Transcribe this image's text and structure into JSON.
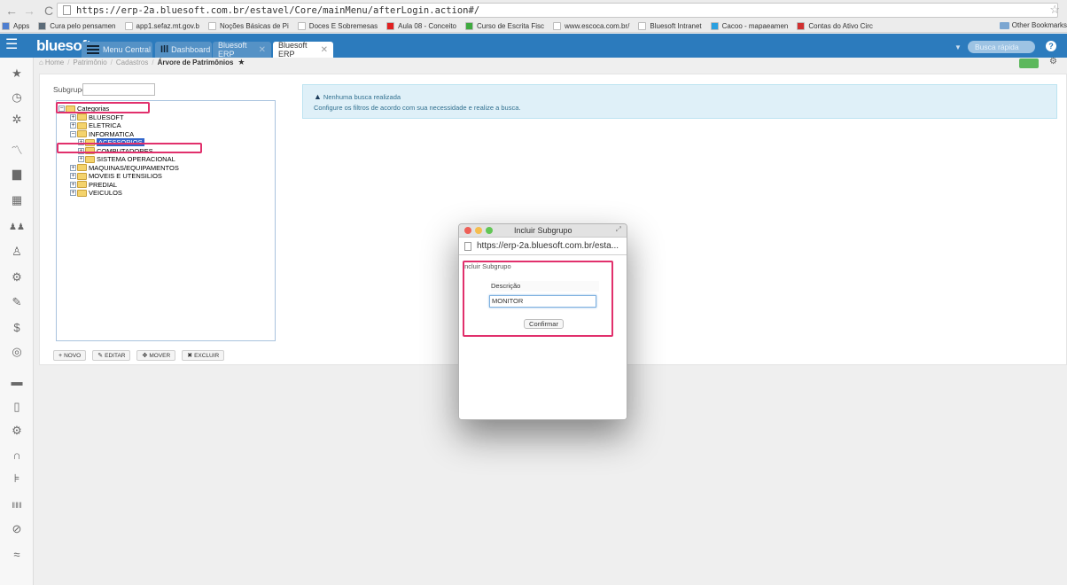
{
  "browser": {
    "url": "https://erp-2a.bluesoft.com.br/estavel/Core/mainMenu/afterLogin.action#/",
    "bookmarks": [
      {
        "label": "Apps",
        "color": "#4f7fd0"
      },
      {
        "label": "Cura pelo pensamen",
        "color": "#5b6b78"
      },
      {
        "label": "app1.sefaz.mt.gov.b",
        "color": "#ffffff"
      },
      {
        "label": "Noções Básicas de Pi",
        "color": "#ffffff"
      },
      {
        "label": "Doces E Sobremesas",
        "color": "#ffffff"
      },
      {
        "label": "Aula 08 - Conceito",
        "color": "#e02020"
      },
      {
        "label": "Curso de Escrita Fisc",
        "color": "#3faa3f"
      },
      {
        "label": "www.escoca.com.br/",
        "color": "#ffffff"
      },
      {
        "label": "Bluesoft Intranet",
        "color": "#ffffff"
      },
      {
        "label": "Cacoo - mapaeamen",
        "color": "#2aa0e0"
      },
      {
        "label": "Contas do Ativo Circ",
        "color": "#d03030"
      }
    ],
    "other_bookmarks": "Other Bookmarks"
  },
  "header": {
    "logo": "bluesoft",
    "tabs": [
      {
        "label": "Menu Central",
        "active": false
      },
      {
        "label": "Dashboard",
        "active": false
      },
      {
        "label": "Bluesoft ERP",
        "active": false
      },
      {
        "label": "Bluesoft ERP",
        "active": true
      }
    ],
    "quick_search_placeholder": "Busca rápida"
  },
  "sidebar": {
    "icons": [
      "star-icon",
      "clock-icon",
      "gear-icon",
      "chart-icon",
      "briefcase-icon",
      "calculator-icon",
      "users-icon",
      "person-icon",
      "cogs-icon",
      "wrench-icon",
      "dollar-icon",
      "dashboard-icon",
      "truck-icon",
      "tablet-icon",
      "gears-icon",
      "headset-icon",
      "cart-icon",
      "barcode-icon",
      "check-circle-icon",
      "sync-icon"
    ]
  },
  "breadcrumb": {
    "items": [
      "Home",
      "Patrimônio",
      "Cadastros",
      "Árvore de Patrimônios"
    ]
  },
  "tree_panel": {
    "subgrupo_label": "Subgrupo:",
    "subgrupo_value": "",
    "nodes": [
      {
        "label": "Categorias",
        "level": 0,
        "expanded": true
      },
      {
        "label": "BLUESOFT",
        "level": 1,
        "expanded": false
      },
      {
        "label": "ELETRICA",
        "level": 1,
        "expanded": false
      },
      {
        "label": "INFORMATICA",
        "level": 1,
        "expanded": true
      },
      {
        "label": "ACESSORIOS",
        "level": 2,
        "expanded": false,
        "selected": true
      },
      {
        "label": "COMPUTADORES",
        "level": 2,
        "expanded": false
      },
      {
        "label": "SISTEMA OPERACIONAL",
        "level": 2,
        "expanded": false
      },
      {
        "label": "MAQUINAS/EQUIPAMENTOS",
        "level": 1,
        "expanded": false
      },
      {
        "label": "MOVEIS E UTENSILIOS",
        "level": 1,
        "expanded": false
      },
      {
        "label": "PREDIAL",
        "level": 1,
        "expanded": false
      },
      {
        "label": "VEICULOS",
        "level": 1,
        "expanded": false
      }
    ],
    "actions": [
      "NOVO",
      "EDITAR",
      "MOVER",
      "EXCLUIR"
    ]
  },
  "info_alert": {
    "title": "Nenhuma busca realizada",
    "text": "Configure os filtros de acordo com sua necessidade e realize a busca."
  },
  "popup": {
    "title": "Incluir Subgrupo",
    "url": "https://erp-2a.bluesoft.com.br/esta...",
    "fieldset_label": "Incluir Subgrupo",
    "descricao_label": "Descrição",
    "descricao_value": "MONITOR",
    "confirm_label": "Confirmar"
  }
}
